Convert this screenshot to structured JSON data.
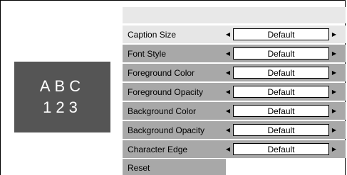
{
  "preview": {
    "line1": "ABC",
    "line2": "123"
  },
  "settings": [
    {
      "label": "Caption Size",
      "value": "Default"
    },
    {
      "label": "Font Style",
      "value": "Default"
    },
    {
      "label": "Foreground Color",
      "value": "Default"
    },
    {
      "label": "Foreground Opacity",
      "value": "Default"
    },
    {
      "label": "Background Color",
      "value": "Default"
    },
    {
      "label": "Background Opacity",
      "value": "Default"
    },
    {
      "label": "Character Edge",
      "value": "Default"
    }
  ],
  "reset_label": "Reset",
  "icons": {
    "left": "left-arrow-icon",
    "right": "right-arrow-icon"
  },
  "colors": {
    "preview_bg": "#555555",
    "row_light": "#e6e6e6",
    "row_dark": "#a8a8a8"
  }
}
